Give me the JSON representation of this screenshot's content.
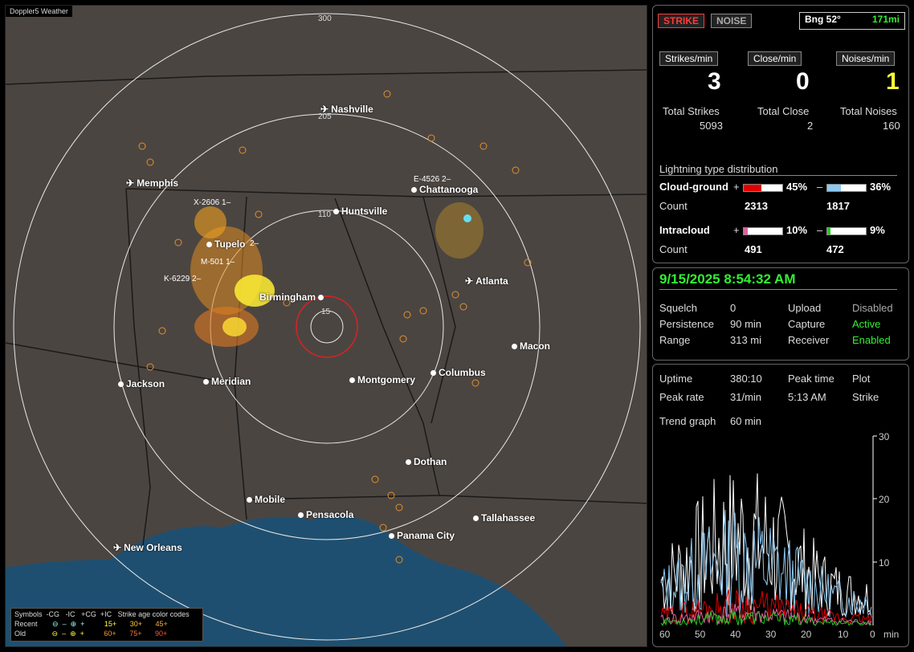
{
  "app": {
    "watermark": "Doppler5 Weather"
  },
  "map": {
    "range_labels": [
      "300",
      "205",
      "110",
      "15"
    ],
    "cities": [
      {
        "name": "Nashville",
        "type": "airport"
      },
      {
        "name": "Memphis",
        "type": "airport"
      },
      {
        "name": "Chattanooga",
        "type": "city"
      },
      {
        "name": "Huntsville",
        "type": "city"
      },
      {
        "name": "Tupelo",
        "type": "city"
      },
      {
        "name": "Birmingham",
        "type": "city"
      },
      {
        "name": "Atlanta",
        "type": "airport"
      },
      {
        "name": "Macon",
        "type": "city"
      },
      {
        "name": "Jackson",
        "type": "city"
      },
      {
        "name": "Meridian",
        "type": "city"
      },
      {
        "name": "Montgomery",
        "type": "city"
      },
      {
        "name": "Columbus",
        "type": "city"
      },
      {
        "name": "Dothan",
        "type": "city"
      },
      {
        "name": "Mobile",
        "type": "city"
      },
      {
        "name": "Pensacola",
        "type": "city"
      },
      {
        "name": "Tallahassee",
        "type": "city"
      },
      {
        "name": "Panama City",
        "type": "city"
      },
      {
        "name": "New Orleans",
        "type": "airport"
      }
    ],
    "cluster_labels": [
      "E-4526  2–",
      "X-2606  1–",
      "M-501  1–",
      "K-6229  2–",
      "2–"
    ]
  },
  "legend": {
    "header": [
      "Symbols",
      "-CG",
      "-IC",
      "+CG",
      "+IC",
      "Strike age color codes"
    ],
    "recent": {
      "label": "Recent",
      "ages": [
        "15+",
        "30+",
        "45+"
      ]
    },
    "old": {
      "label": "Old",
      "ages": [
        "60+",
        "75+",
        "90+"
      ]
    }
  },
  "stats": {
    "strike_btn": "STRIKE",
    "noise_btn": "NOISE",
    "bearing": "Bng 52°",
    "distance": "171mi",
    "rate_buttons": [
      "Strikes/min",
      "Close/min",
      "Noises/min"
    ],
    "rates": [
      "3",
      "0",
      "1"
    ],
    "total_labels": [
      "Total Strikes",
      "Total Close",
      "Total Noises"
    ],
    "totals": [
      "5093",
      "2",
      "160"
    ],
    "dist_title": "Lightning type distribution",
    "cg_label": "Cloud-ground",
    "ic_label": "Intracloud",
    "count_label": "Count",
    "plus": "+",
    "minus": "–",
    "cg_pos_pct": "45%",
    "cg_neg_pct": "36%",
    "ic_pos_pct": "10%",
    "ic_neg_pct": "9%",
    "cg_pos_count": "2313",
    "cg_neg_count": "1817",
    "ic_pos_count": "491",
    "ic_neg_count": "472",
    "cg_pos_frac": 0.45,
    "cg_neg_frac": 0.36,
    "ic_pos_frac": 0.1,
    "ic_neg_frac": 0.09
  },
  "status": {
    "datetime": "9/15/2025 8:54:32 AM",
    "rows": [
      [
        "Squelch",
        "0",
        "Upload",
        "Disabled"
      ],
      [
        "Persistence",
        "90 min",
        "Capture",
        "Active"
      ],
      [
        "Range",
        "313 mi",
        "Receiver",
        "Enabled"
      ]
    ]
  },
  "trend": {
    "uptime_label": "Uptime",
    "uptime": "380:10",
    "peak_time_label": "Peak time",
    "plot_label": "Plot",
    "peak_rate_label": "Peak rate",
    "peak_rate": "31/min",
    "peak_time": "5:13 AM",
    "plot_value": "Strike",
    "trend_label": "Trend graph",
    "trend_value": "60 min",
    "y_ticks": [
      "30",
      "20",
      "10"
    ],
    "x_ticks": [
      "60",
      "50",
      "40",
      "30",
      "20",
      "10",
      "0"
    ],
    "x_unit": "min"
  },
  "colors": {
    "strike": "#ff3b3b",
    "green": "#33ee33",
    "yellow": "#ffff33",
    "cg_pos": "#e00000",
    "cg_neg": "#8cc8f0",
    "ic_pos": "#e060a0",
    "ic_neg": "#22cc22"
  }
}
